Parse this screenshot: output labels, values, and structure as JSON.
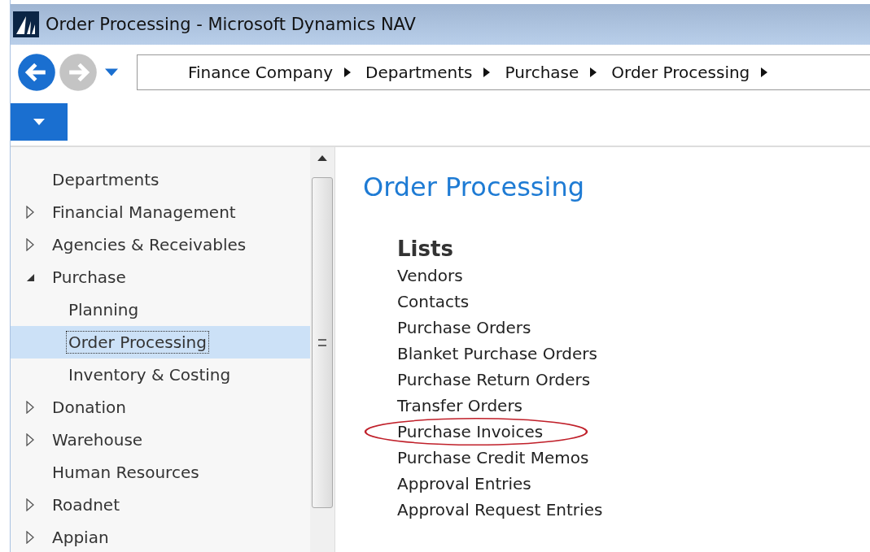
{
  "window": {
    "title": "Order Processing - Microsoft Dynamics NAV"
  },
  "navigation": {
    "back_disabled": false,
    "forward_disabled": true,
    "breadcrumb": [
      "Finance Company",
      "Departments",
      "Purchase",
      "Order Processing"
    ]
  },
  "sidebar": {
    "items": [
      {
        "label": "Departments",
        "kind": "plain",
        "selected": false
      },
      {
        "label": "Financial Management",
        "kind": "folder",
        "expanded": false,
        "selected": false
      },
      {
        "label": "Agencies & Receivables",
        "kind": "folder",
        "expanded": false,
        "selected": false
      },
      {
        "label": "Purchase",
        "kind": "folder",
        "expanded": true,
        "selected": false,
        "children": [
          {
            "label": "Planning",
            "kind": "plain",
            "selected": false
          },
          {
            "label": "Order Processing",
            "kind": "plain",
            "selected": true
          },
          {
            "label": "Inventory & Costing",
            "kind": "plain",
            "selected": false
          }
        ]
      },
      {
        "label": "Donation",
        "kind": "folder",
        "expanded": false,
        "selected": false
      },
      {
        "label": "Warehouse",
        "kind": "folder",
        "expanded": false,
        "selected": false
      },
      {
        "label": "Human Resources",
        "kind": "plain",
        "selected": false
      },
      {
        "label": "Roadnet",
        "kind": "folder",
        "expanded": false,
        "selected": false
      },
      {
        "label": "Appian",
        "kind": "folder",
        "expanded": false,
        "selected": false
      }
    ]
  },
  "content": {
    "title": "Order Processing",
    "section": "Lists",
    "links": [
      {
        "label": "Vendors",
        "circled": false
      },
      {
        "label": "Contacts",
        "circled": false
      },
      {
        "label": "Purchase Orders",
        "circled": false
      },
      {
        "label": "Blanket Purchase Orders",
        "circled": false
      },
      {
        "label": "Purchase Return Orders",
        "circled": false
      },
      {
        "label": "Transfer Orders",
        "circled": false
      },
      {
        "label": "Purchase Invoices",
        "circled": true
      },
      {
        "label": "Purchase Credit Memos",
        "circled": false
      },
      {
        "label": "Approval Entries",
        "circled": false
      },
      {
        "label": "Approval Request Entries",
        "circled": false
      }
    ]
  }
}
